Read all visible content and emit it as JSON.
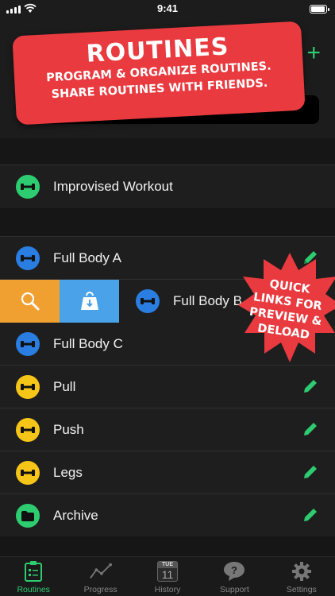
{
  "status": {
    "time": "9:41"
  },
  "promo": {
    "title": "ROUTINES",
    "line1": "PROGRAM & ORGANIZE ROUTINES.",
    "line2": "SHARE ROUTINES WITH FRIENDS."
  },
  "header": {
    "add_label": "+"
  },
  "improvised": {
    "label": "Improvised Workout"
  },
  "routines": [
    {
      "label": "Full Body A",
      "color": "#2a7de1",
      "editable": true
    },
    {
      "label": "Full Body B",
      "color": "#2a7de1",
      "editable": false
    },
    {
      "label": "Full Body C",
      "color": "#2a7de1",
      "editable": false
    },
    {
      "label": "Pull",
      "color": "#f5c518",
      "editable": true
    },
    {
      "label": "Push",
      "color": "#f5c518",
      "editable": true
    },
    {
      "label": "Legs",
      "color": "#f5c518",
      "editable": true
    },
    {
      "label": "Archive",
      "color": "#2ecc71",
      "editable": true
    }
  ],
  "swipe_actions": {
    "preview": {
      "icon": "magnifier-icon",
      "color": "#f0a030"
    },
    "deload": {
      "icon": "weight-down-icon",
      "color": "#4aa3e8"
    }
  },
  "callout": {
    "line1": "QUICK",
    "line2": "LINKS FOR",
    "line3": "PREVIEW &",
    "line4": "DELOAD"
  },
  "tabs": {
    "routines": "Routines",
    "progress": "Progress",
    "history": "History",
    "support": "Support",
    "settings": "Settings",
    "calendar_month": "TUE",
    "calendar_day": "11"
  },
  "colors": {
    "accent": "#2ecc71",
    "promo": "#e83a3f",
    "blue": "#2a7de1",
    "yellow": "#f5c518",
    "green": "#2ecc71"
  }
}
